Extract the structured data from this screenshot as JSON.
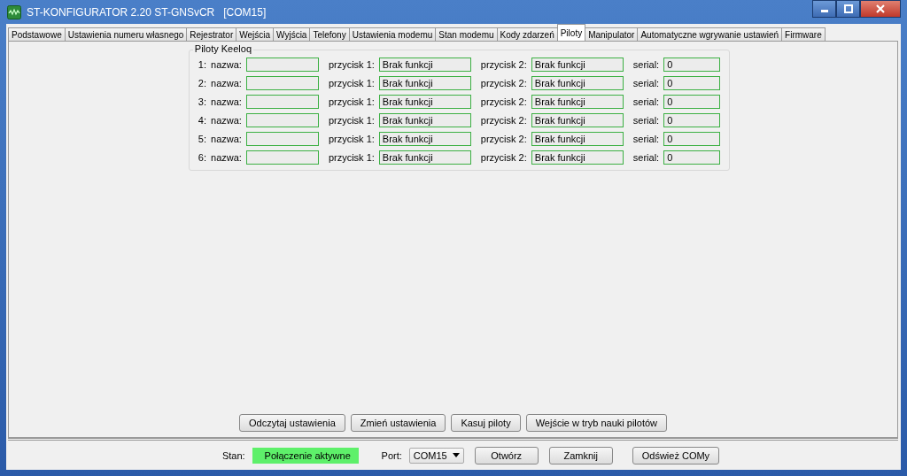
{
  "window": {
    "title": "ST-KONFIGURATOR 2.20 ST-GNSvCR   [COM15]"
  },
  "tabs": [
    {
      "label": "Podstawowe",
      "selected": false
    },
    {
      "label": "Ustawienia numeru własnego",
      "selected": false
    },
    {
      "label": "Rejestrator",
      "selected": false
    },
    {
      "label": "Wejścia",
      "selected": false
    },
    {
      "label": "Wyjścia",
      "selected": false
    },
    {
      "label": "Telefony",
      "selected": false
    },
    {
      "label": "Ustawienia modemu",
      "selected": false
    },
    {
      "label": "Stan modemu",
      "selected": false
    },
    {
      "label": "Kody zdarzeń",
      "selected": false
    },
    {
      "label": "Piloty",
      "selected": true
    },
    {
      "label": "Manipulator",
      "selected": false
    },
    {
      "label": "Automatyczne wgrywanie ustawień",
      "selected": false
    },
    {
      "label": "Firmware",
      "selected": false
    }
  ],
  "group": {
    "title": "Piloty Keeloq",
    "rows": [
      {
        "index": "1:",
        "name_label": "nazwa:",
        "button1_label": "przycisk 1:",
        "button1": "Brak funkcji",
        "button2_label": "przycisk 2:",
        "button2": "Brak funkcji",
        "serial_label": "serial:",
        "serial": "0"
      },
      {
        "index": "2:",
        "name_label": "nazwa:",
        "button1_label": "przycisk 1:",
        "button1": "Brak funkcji",
        "button2_label": "przycisk 2:",
        "button2": "Brak funkcji",
        "serial_label": "serial:",
        "serial": "0"
      },
      {
        "index": "3:",
        "name_label": "nazwa:",
        "button1_label": "przycisk 1:",
        "button1": "Brak funkcji",
        "button2_label": "przycisk 2:",
        "button2": "Brak funkcji",
        "serial_label": "serial:",
        "serial": "0"
      },
      {
        "index": "4:",
        "name_label": "nazwa:",
        "button1_label": "przycisk 1:",
        "button1": "Brak funkcji",
        "button2_label": "przycisk 2:",
        "button2": "Brak funkcji",
        "serial_label": "serial:",
        "serial": "0"
      },
      {
        "index": "5:",
        "name_label": "nazwa:",
        "button1_label": "przycisk 1:",
        "button1": "Brak funkcji",
        "button2_label": "przycisk 2:",
        "button2": "Brak funkcji",
        "serial_label": "serial:",
        "serial": "0"
      },
      {
        "index": "6:",
        "name_label": "nazwa:",
        "button1_label": "przycisk 1:",
        "button1": "Brak funkcji",
        "button2_label": "przycisk 2:",
        "button2": "Brak funkcji",
        "serial_label": "serial:",
        "serial": "0"
      }
    ]
  },
  "actions": [
    "Odczytaj ustawienia",
    "Zmień ustawienia",
    "Kasuj piloty",
    "Wejście w tryb nauki pilotów"
  ],
  "status_bar": {
    "state_label": "Stan:",
    "state": "Połączenie aktywne",
    "port_label": "Port:",
    "port": "COM15",
    "buttons": [
      "Otwórz",
      "Zamknij",
      "Odśwież COMy"
    ]
  }
}
